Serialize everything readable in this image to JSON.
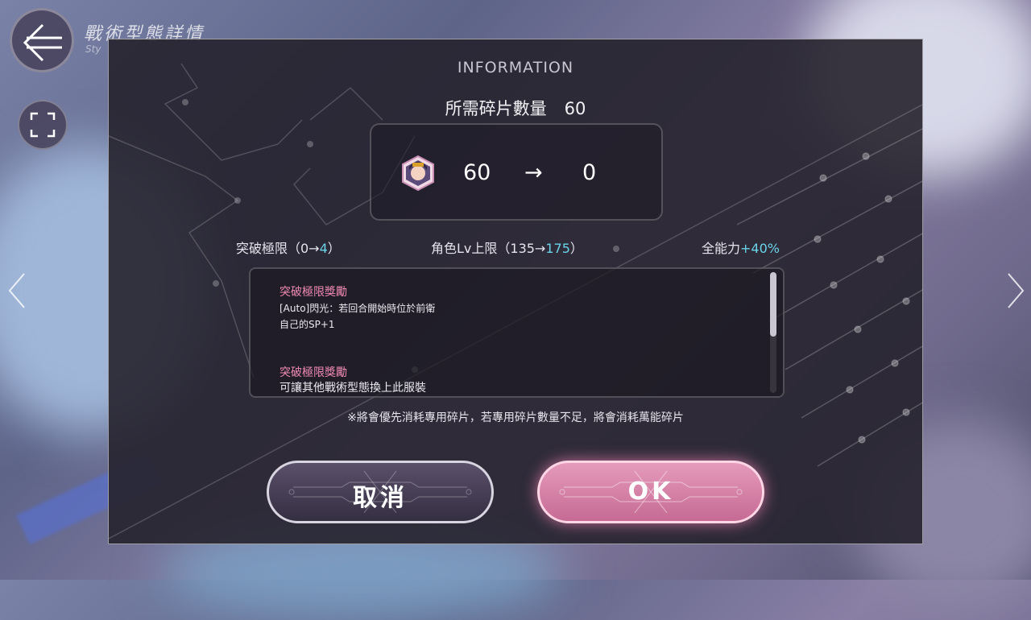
{
  "header": {
    "title": "戰術型態詳情",
    "subtitle": "Sty"
  },
  "dialog": {
    "title": "INFORMATION",
    "required_label": "所需碎片數量",
    "required_value": "60",
    "shard_from": "60",
    "shard_arrow": "→",
    "shard_to": "0",
    "stats": {
      "limit_break_prefix": "突破極限（0→",
      "limit_break_value": "4",
      "limit_break_suffix": "）",
      "level_cap_prefix": "角色Lv上限（135→",
      "level_cap_value": "175",
      "level_cap_suffix": "）",
      "power_prefix": "全能力",
      "power_value": "+40%"
    },
    "rewards": [
      {
        "title": "突破極限獎勵",
        "lines": [
          "[Auto]閃光：若回合開始時位於前衛",
          "自己的SP+1"
        ]
      },
      {
        "title": "突破極限獎勵",
        "lines": [
          "可讓其他戰術型態換上此服裝"
        ]
      }
    ],
    "note": "※將會優先消耗專用碎片，若專用碎片數量不足，將會消耗萬能碎片",
    "cancel_label": "取消",
    "ok_label": "OK"
  },
  "icons": {
    "back": "back-arrow-icon",
    "expand": "fullscreen-icon",
    "prev": "chevron-left-icon",
    "next": "chevron-right-icon",
    "shard": "character-shard-icon"
  },
  "colors": {
    "highlight": "#6ad4e8",
    "reward_title": "#f08ab4",
    "ok_button": "#d47aa2"
  }
}
